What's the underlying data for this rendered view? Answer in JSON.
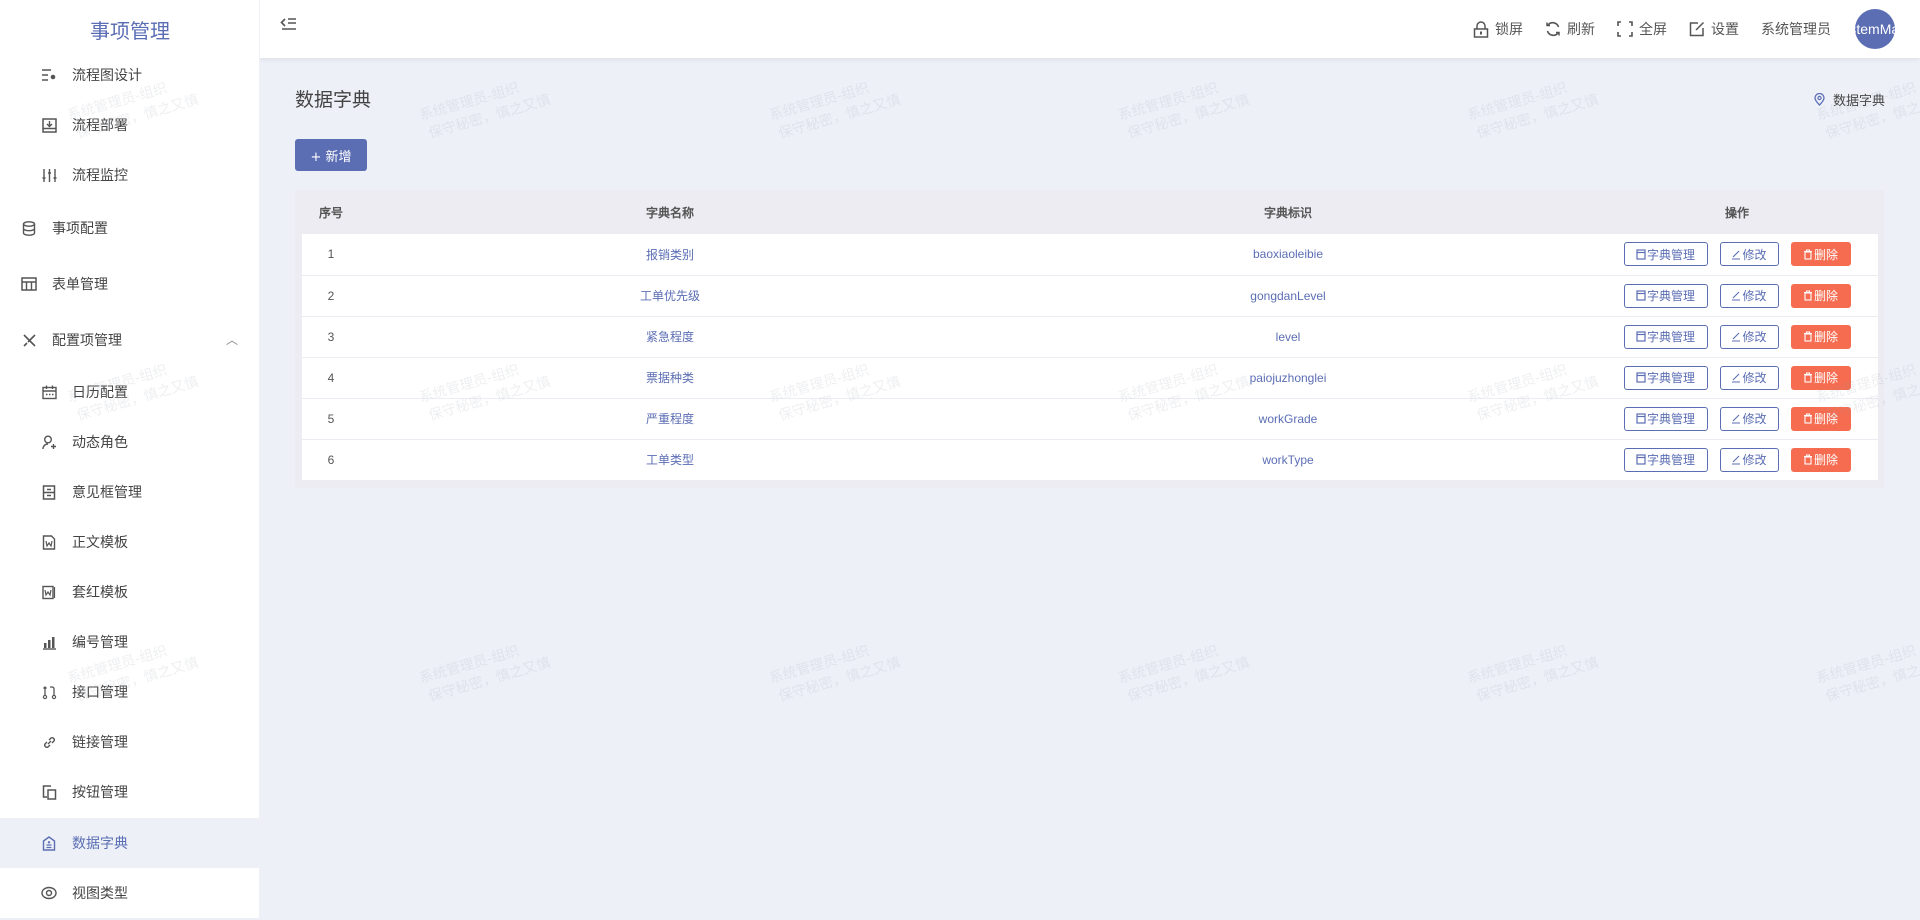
{
  "app": {
    "title": "事项管理"
  },
  "sidebar": {
    "items": [
      {
        "label": "流程图设计",
        "icon": "flow-design-icon",
        "level": "sub"
      },
      {
        "label": "流程部署",
        "icon": "deploy-icon",
        "level": "sub"
      },
      {
        "label": "流程监控",
        "icon": "monitor-icon",
        "level": "sub"
      },
      {
        "label": "事项配置",
        "icon": "database-icon",
        "level": "top"
      },
      {
        "label": "表单管理",
        "icon": "table-icon",
        "level": "top"
      },
      {
        "label": "配置项管理",
        "icon": "tools-icon",
        "level": "top",
        "expanded": true
      },
      {
        "label": "日历配置",
        "icon": "calendar-icon",
        "level": "sub"
      },
      {
        "label": "动态角色",
        "icon": "user-add-icon",
        "level": "sub"
      },
      {
        "label": "意见框管理",
        "icon": "opinion-box-icon",
        "level": "sub"
      },
      {
        "label": "正文模板",
        "icon": "doc-template-icon",
        "level": "sub"
      },
      {
        "label": "套红模板",
        "icon": "red-template-icon",
        "level": "sub"
      },
      {
        "label": "编号管理",
        "icon": "bar-chart-icon",
        "level": "sub"
      },
      {
        "label": "接口管理",
        "icon": "api-icon",
        "level": "sub"
      },
      {
        "label": "链接管理",
        "icon": "link-icon",
        "level": "sub"
      },
      {
        "label": "按钮管理",
        "icon": "button-icon",
        "level": "sub"
      },
      {
        "label": "数据字典",
        "icon": "dictionary-icon",
        "level": "sub",
        "active": true
      },
      {
        "label": "视图类型",
        "icon": "eye-icon",
        "level": "sub"
      }
    ]
  },
  "header": {
    "lock_label": "锁屏",
    "refresh_label": "刷新",
    "fullscreen_label": "全屏",
    "settings_label": "设置",
    "username": "系统管理员",
    "avatar_text": "SystemMan"
  },
  "page": {
    "title": "数据字典",
    "breadcrumb": "数据字典",
    "add_button": "+ 新增"
  },
  "table": {
    "columns": [
      "序号",
      "字典名称",
      "字典标识",
      "操作"
    ],
    "rows": [
      {
        "index": "1",
        "name": "报销类别",
        "key": "baoxiaoleibie"
      },
      {
        "index": "2",
        "name": "工单优先级",
        "key": "gongdanLevel"
      },
      {
        "index": "3",
        "name": "紧急程度",
        "key": "level"
      },
      {
        "index": "4",
        "name": "票据种类",
        "key": "paiojuzhonglei"
      },
      {
        "index": "5",
        "name": "严重程度",
        "key": "workGrade"
      },
      {
        "index": "6",
        "name": "工单类型",
        "key": "workType"
      }
    ],
    "actions": {
      "dict_manage": "字典管理",
      "edit": "修改",
      "delete": "删除"
    }
  },
  "watermark": {
    "line1": "系统管理员-组织",
    "line2": "保守秘密，慎之又慎"
  },
  "colors": {
    "primary": "#5b6eb4",
    "danger": "#f56c50",
    "background": "#edf0f7"
  }
}
